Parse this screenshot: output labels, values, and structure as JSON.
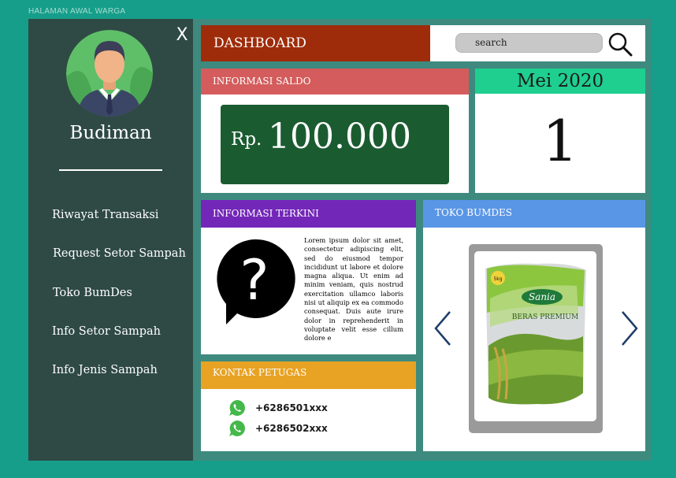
{
  "page_label": "HALAMAN AWAL WARGA",
  "sidebar": {
    "close_label": "X",
    "user_name": "Budiman",
    "menu": [
      {
        "label": "Riwayat Transaksi"
      },
      {
        "label": "Request Setor Sampah"
      },
      {
        "label": "Toko BumDes"
      },
      {
        "label": "Info Setor Sampah"
      },
      {
        "label": "Info Jenis Sampah"
      }
    ]
  },
  "header": {
    "title": "DASHBOARD",
    "search_placeholder": "search"
  },
  "saldo": {
    "title": "INFORMASI SALDO",
    "currency": "Rp.",
    "amount": "100.000"
  },
  "calendar": {
    "month": "Mei 2020",
    "day": "1"
  },
  "news": {
    "title": "INFORMASI TERKINI",
    "body": "Lorem ipsum dolor sit amet, consectetur adipiscing elit, sed do eiusmod tempor incididunt ut labore et dolore magna aliqua. Ut enim ad minim veniam, quis nostrud exercitation ullamco laboris nisi ut aliquip ex ea commodo consequat. Duis aute irure dolor in reprehenderit in voluptate velit esse cillum dolore e"
  },
  "contact": {
    "title": "KONTAK PETUGAS",
    "numbers": [
      "+6286501xxx",
      "+6286502xxx"
    ]
  },
  "shop": {
    "title": "TOKO BUMDES",
    "product_brand": "Sania",
    "product_name": "BERAS PREMIUM",
    "product_weight": "5kg"
  },
  "colors": {
    "background": "#169e8a",
    "sidebar": "#2f4a45",
    "dashboard": "#9e2c0a",
    "saldo_header": "#d45c5c",
    "saldo_box": "#1a5c30",
    "calendar_header": "#1fcf8f",
    "news_header": "#7327b8",
    "contact_header": "#e8a324",
    "shop_header": "#5a96e6"
  },
  "icons": [
    "close-icon",
    "avatar",
    "search-icon",
    "question-bubble-icon",
    "whatsapp-icon",
    "chevron-left-icon",
    "chevron-right-icon"
  ]
}
